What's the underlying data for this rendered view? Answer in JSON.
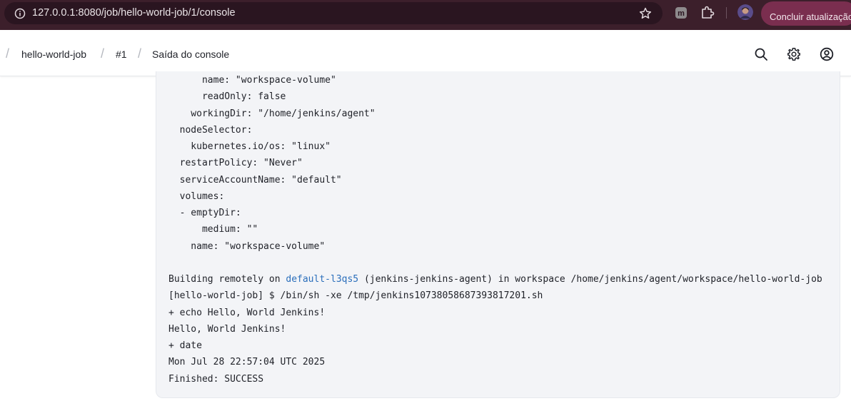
{
  "browser": {
    "url": "127.0.0.1:8080/job/hello-world-job/1/console",
    "update_label": "Concluir atualização",
    "extension_letter": "m"
  },
  "breadcrumb": {
    "items": [
      {
        "label": "hello-world-job"
      },
      {
        "label": "#1"
      },
      {
        "label": "Saída do console"
      }
    ]
  },
  "header_icons": [
    "search-icon",
    "gear-icon",
    "user-icon"
  ],
  "console": {
    "lines": [
      "      name: \"workspace-volume\"",
      "      readOnly: false",
      "    workingDir: \"/home/jenkins/agent\"",
      "  nodeSelector:",
      "    kubernetes.io/os: \"linux\"",
      "  restartPolicy: \"Never\"",
      "  serviceAccountName: \"default\"",
      "  volumes:",
      "  - emptyDir:",
      "      medium: \"\"",
      "    name: \"workspace-volume\"",
      ""
    ],
    "building_prefix": "Building remotely on ",
    "agent_link": "default-l3qs5",
    "building_suffix": " (jenkins-jenkins-agent) in workspace /home/jenkins/agent/workspace/hello-world-job",
    "tail_lines": [
      "[hello-world-job] $ /bin/sh -xe /tmp/jenkins10738058687393817201.sh",
      "+ echo Hello, World Jenkins!",
      "Hello, World Jenkins!",
      "+ date",
      "Mon Jul 28 22:57:04 UTC 2025",
      "Finished: SUCCESS"
    ]
  },
  "colors": {
    "browser_bar": "#3c1f2b",
    "update_button": "#7a2e4f",
    "link": "#2a6ebb",
    "console_bg": "#f3f4f7"
  }
}
